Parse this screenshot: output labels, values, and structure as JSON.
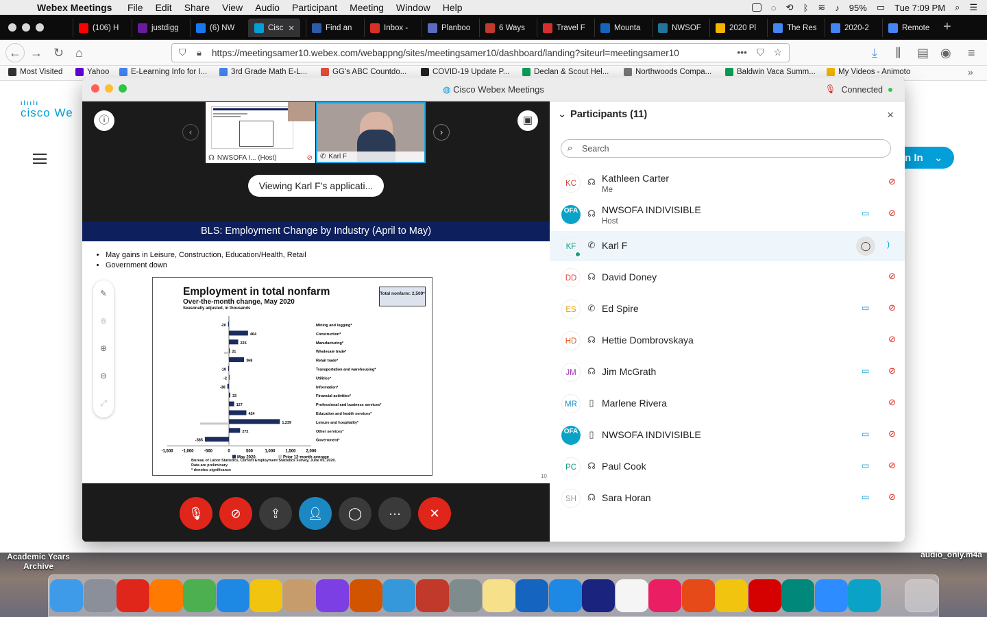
{
  "menubar": {
    "app_name": "Webex Meetings",
    "menus": [
      "File",
      "Edit",
      "Share",
      "View",
      "Audio",
      "Participant",
      "Meeting",
      "Window",
      "Help"
    ],
    "battery": "95%",
    "clock": "Tue 7:09 PM"
  },
  "browser": {
    "tabs": [
      {
        "label": "(106) H",
        "color": "#ff0000"
      },
      {
        "label": "justdigg",
        "color": "#6a1b9a"
      },
      {
        "label": "(6) NW",
        "color": "#1877f2"
      },
      {
        "label": "Cisc",
        "color": "#049fd9"
      },
      {
        "label": "Find an",
        "color": "#2e5aac"
      },
      {
        "label": "Inbox -",
        "color": "#d93025"
      },
      {
        "label": "Planboo",
        "color": "#5c6bc0"
      },
      {
        "label": "6 Ways",
        "color": "#c0392b"
      },
      {
        "label": "Travel F",
        "color": "#d32f2f"
      },
      {
        "label": "Mounta",
        "color": "#1565c0"
      },
      {
        "label": "NWSOF",
        "color": "#21759b"
      },
      {
        "label": "2020 Pl",
        "color": "#f4b400"
      },
      {
        "label": "The Res",
        "color": "#4285f4"
      },
      {
        "label": "2020-2",
        "color": "#4285f4"
      },
      {
        "label": "Remote",
        "color": "#4285f4"
      }
    ],
    "new_tab": "+",
    "url": "https://meetingsamer10.webex.com/webappng/sites/meetingsamer10/dashboard/landing?siteurl=meetingsamer10",
    "bookmarks": [
      "Most Visited",
      "Yahoo",
      "E-Learning Info for I...",
      "3rd Grade Math E-L...",
      "GG's ABC Countdo...",
      "COVID-19 Update P...",
      "Declan & Scout Hel...",
      "Northwoods Compa...",
      "Baldwin Vaca Summ...",
      "My Videos - Animoto"
    ]
  },
  "background_page": {
    "logo_text": "cisco We",
    "signin_label": "n In"
  },
  "webex": {
    "window_title": "Cisco Webex Meetings",
    "connection_status": "Connected",
    "thumbnails": [
      {
        "label": "NWSOFA I...  (Host)"
      },
      {
        "label": "Karl F"
      }
    ],
    "viewing_label": "Viewing Karl F's applicati...",
    "slide": {
      "header": "BLS:  Employment Change by Industry (April to May)",
      "bullets": [
        "May gains in Leisure, Construction, Education/Health, Retail",
        "Government down"
      ],
      "page_number": "10",
      "chart_title": "Employment in total nonfarm",
      "chart_subtitle": "Over-the-month change, May 2020",
      "chart_subtitle2": "Seasonally adjusted, in thousands",
      "total_box": "Total nonfarm: 2,509*",
      "legend": [
        "May 2020",
        "Prior 12-month average"
      ],
      "source": "Bureau of Labor Statistics, Current Employment Statistics survey, June 05, 2020.",
      "source2": "Data are preliminary.",
      "source3": "* denotes significance"
    },
    "participants_title": "Participants (11)",
    "search_placeholder": "Search",
    "participants": [
      {
        "initials": "KC",
        "name": "Kathleen Carter",
        "role": "Me",
        "device": "headset",
        "video": false,
        "color": "#e0413a"
      },
      {
        "initials": "OFA",
        "name": "NWSOFA INDIVISIBLE",
        "role": "Host",
        "device": "headset",
        "video": true,
        "color": "#0aa3c7"
      },
      {
        "initials": "KF",
        "name": "Karl F",
        "role": "",
        "device": "phone",
        "video": false,
        "color": "#16a085"
      },
      {
        "initials": "DD",
        "name": "David Doney",
        "role": "",
        "device": "headset",
        "video": false,
        "color": "#e0413a"
      },
      {
        "initials": "ES",
        "name": "Ed Spire",
        "role": "",
        "device": "phone",
        "video": true,
        "color": "#e69b00"
      },
      {
        "initials": "HD",
        "name": "Hettie Dombrovskaya",
        "role": "",
        "device": "headset",
        "video": false,
        "color": "#e05a1a"
      },
      {
        "initials": "JM",
        "name": "Jim McGrath",
        "role": "",
        "device": "headset",
        "video": true,
        "color": "#a02bb3"
      },
      {
        "initials": "MR",
        "name": "Marlene Rivera",
        "role": "",
        "device": "mobile",
        "video": false,
        "color": "#1a8fc4"
      },
      {
        "initials": "OFA",
        "name": "NWSOFA INDIVISIBLE",
        "role": "",
        "device": "mobile",
        "video": true,
        "color": "#0aa3c7"
      },
      {
        "initials": "PC",
        "name": "Paul Cook",
        "role": "",
        "device": "headset",
        "video": true,
        "color": "#16a085"
      },
      {
        "initials": "SH",
        "name": "Sara Horan",
        "role": "",
        "device": "headset",
        "video": true,
        "color": "#999999"
      }
    ]
  },
  "desktop": {
    "folder_label": "Academic Years Archive",
    "file_label": "audio_only.m4a"
  },
  "chart_data": {
    "type": "bar",
    "orientation": "horizontal",
    "title": "Employment in total nonfarm",
    "subtitle": "Over-the-month change, May 2020",
    "xlim": [
      -1500,
      2000
    ],
    "xticks": [
      "-1,500",
      "-1,000",
      "-500",
      "0",
      "500",
      "1,000",
      "1,500",
      "2,000"
    ],
    "categories": [
      "Mining and logging*",
      "Construction*",
      "Manufacturing*",
      "Wholesale trade*",
      "Retail trade*",
      "Transportation and warehousing*",
      "Utilities*",
      "Information*",
      "Financial activities*",
      "Professional and business services*",
      "Education and health services*",
      "Leisure and hospitality*",
      "Other services*",
      "Government*"
    ],
    "series": [
      {
        "name": "May 2020",
        "values": [
          -20,
          464,
          225,
          21,
          368,
          -19,
          -2,
          -38,
          33,
          127,
          424,
          1239,
          272,
          -585
        ],
        "color": "#1c2c5e"
      },
      {
        "name": "Prior 12-month average",
        "values": [
          0,
          10,
          0,
          -120,
          -10,
          20,
          0,
          0,
          10,
          20,
          30,
          -700,
          0,
          -15
        ],
        "color": "#c8c8c8"
      }
    ],
    "data_labels": [
      "-20",
      "464",
      "225",
      "21",
      "368",
      "-19",
      "-2",
      "-38",
      "33",
      "127",
      "424",
      "1,239",
      "272",
      "-585"
    ]
  }
}
